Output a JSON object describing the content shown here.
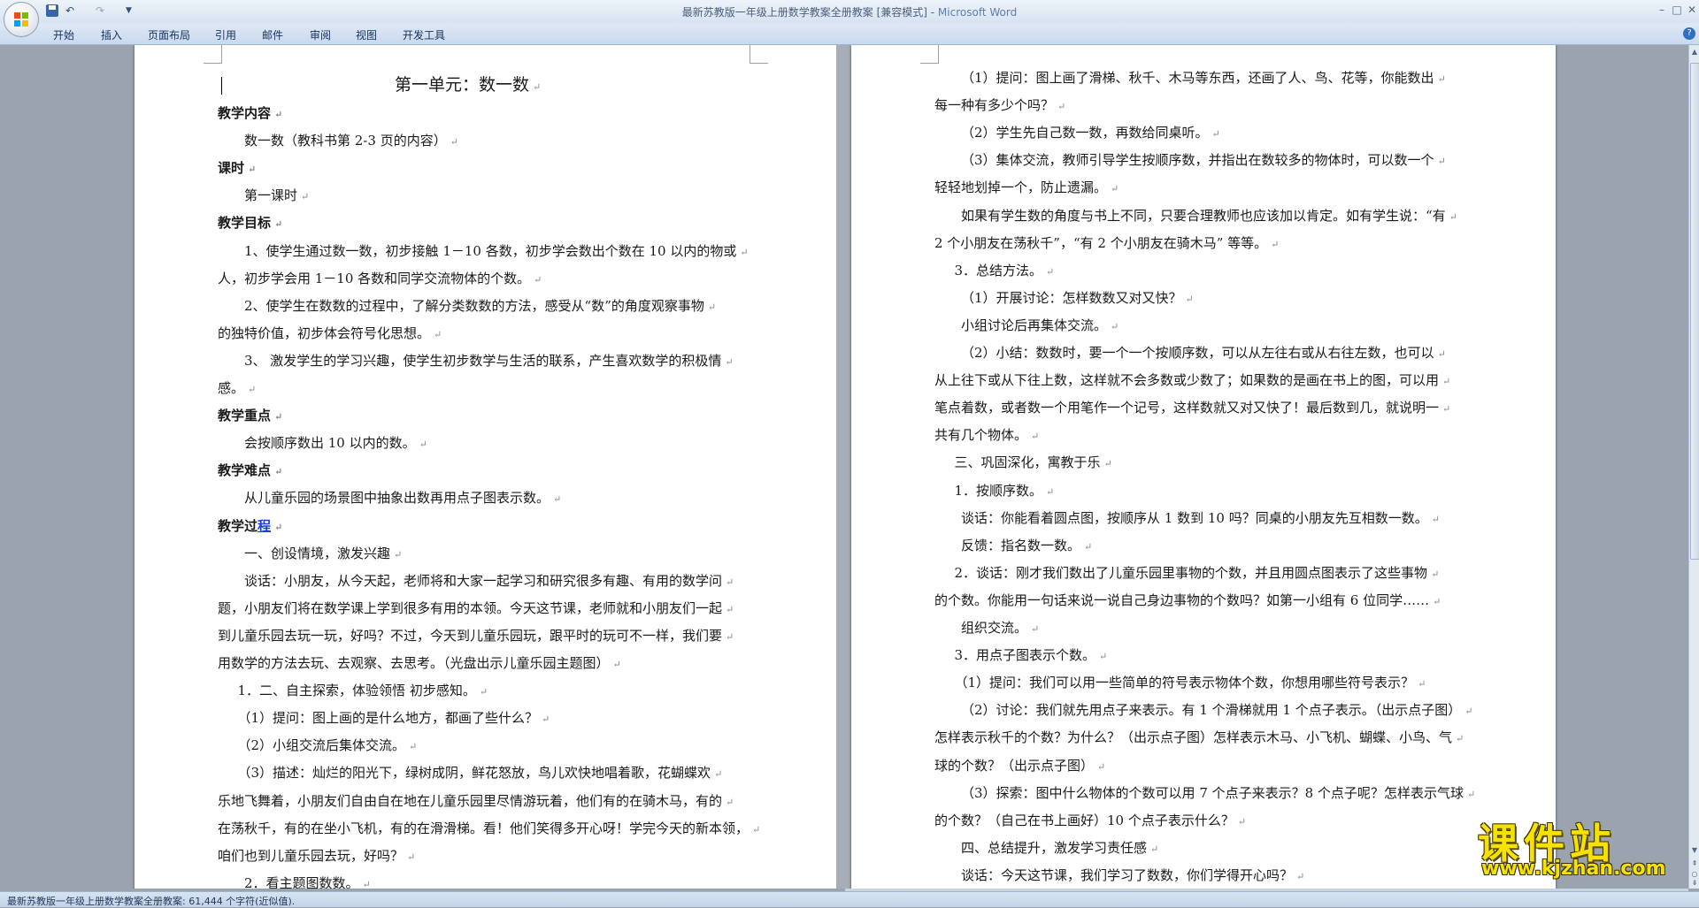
{
  "window": {
    "title": "最新苏教版一年级上册数学教案全册教案 [兼容模式] - ",
    "app_name": "Microsoft Word"
  },
  "qat": {
    "undo": "↶",
    "redo": "↷",
    "dropdown": "▼"
  },
  "ribbon": {
    "tabs": [
      "开始",
      "插入",
      "页面布局",
      "引用",
      "邮件",
      "审阅",
      "视图",
      "开发工具"
    ],
    "help": "?"
  },
  "window_buttons": {
    "minimize": "–",
    "maximize": "□",
    "close": "✕"
  },
  "page_left": {
    "heading": "第一单元：数一数",
    "lines": [
      {
        "text": "教学内容",
        "bold": true,
        "indent": 0
      },
      {
        "text": "数一数（教科书第 2-3 页的内容）",
        "bold": false,
        "indent": 2
      },
      {
        "text": "课时",
        "bold": true,
        "indent": 0
      },
      {
        "text": "第一课时",
        "bold": false,
        "indent": 2
      },
      {
        "text": "教学目标",
        "bold": true,
        "indent": 0
      },
      {
        "text": "1、使学生通过数一数，初步接触 1－10 各数，初步学会数出个数在 10 以内的物或",
        "bold": false,
        "indent": 2
      },
      {
        "text": "人，初步学会用 1－10 各数和同学交流物体的个数。",
        "bold": false,
        "indent": 0
      },
      {
        "text": "2、使学生在数数的过程中，了解分类数数的方法，感受从“数”的角度观察事物",
        "bold": false,
        "indent": 2
      },
      {
        "text": "的独特价值，初步体会符号化思想。",
        "bold": false,
        "indent": 0
      },
      {
        "text": "3、 激发学生的学习兴趣，使学生初步数学与生活的联系，产生喜欢数学的积极情",
        "bold": false,
        "indent": 2
      },
      {
        "text": "感。",
        "bold": false,
        "indent": 0
      },
      {
        "text": "教学重点",
        "bold": true,
        "indent": 0
      },
      {
        "text": "会按顺序数出 10 以内的数。",
        "bold": false,
        "indent": 2
      },
      {
        "text": "教学难点",
        "bold": true,
        "indent": 0
      },
      {
        "text": "从儿童乐园的场景图中抽象出数再用点子图表示数。",
        "bold": false,
        "indent": 2
      },
      {
        "text": "教学过",
        "bold": true,
        "indent": 0,
        "link": "程"
      },
      {
        "text": "一、创设情境，激发兴趣",
        "bold": false,
        "indent": 2
      },
      {
        "text": "谈话：小朋友，从今天起，老师将和大家一起学习和研究很多有趣、有用的数学问",
        "bold": false,
        "indent": 2
      },
      {
        "text": "题，小朋友们将在数学课上学到很多有用的本领。今天这节课，老师就和小朋友们一起",
        "bold": false,
        "indent": 0
      },
      {
        "text": "到儿童乐园去玩一玩，好吗？不过，今天到儿童乐园玩，跟平时的玩可不一样，我们要",
        "bold": false,
        "indent": 0
      },
      {
        "text": "用数学的方法去玩、去观察、去思考。（光盘出示儿童乐园主题图）",
        "bold": false,
        "indent": 0
      },
      {
        "text": "1．二、自主探索，体验领悟   初步感知。",
        "bold": false,
        "indent": 1.5
      },
      {
        "text": "（1）提问：图上画的是什么地方，都画了些什么？",
        "bold": false,
        "indent": 1.5
      },
      {
        "text": "（2）小组交流后集体交流。",
        "bold": false,
        "indent": 1.5
      },
      {
        "text": "（3）描述：灿烂的阳光下，绿树成阴，鲜花怒放，鸟儿欢快地唱着歌，花蝴蝶欢",
        "bold": false,
        "indent": 1.5
      },
      {
        "text": "乐地飞舞着，小朋友们自由自在地在儿童乐园里尽情游玩着，他们有的在骑木马，有的",
        "bold": false,
        "indent": 0
      },
      {
        "text": "在荡秋千，有的在坐小飞机，有的在滑滑梯。看！他们笑得多开心呀！学完今天的新本领，",
        "bold": false,
        "indent": 0
      },
      {
        "text": "咱们也到儿童乐园去玩，好吗？",
        "bold": false,
        "indent": 0
      },
      {
        "text": "2．看主题图数数。",
        "bold": false,
        "indent": 2
      }
    ]
  },
  "page_right": {
    "lines": [
      {
        "text": "（1）提问：图上画了滑梯、秋千、木马等东西，还画了人、鸟、花等，你能数出",
        "indent": 2
      },
      {
        "text": "每一种有多少个吗？",
        "indent": 0
      },
      {
        "text": "（2）学生先自己数一数，再数给同桌听。",
        "indent": 2
      },
      {
        "text": "（3）集体交流，教师引导学生按顺序数，并指出在数较多的物体时，可以数一个",
        "indent": 2
      },
      {
        "text": "轻轻地划掉一个，防止遗漏。",
        "indent": 0
      },
      {
        "text": "如果有学生数的角度与书上不同，只要合理教师也应该加以肯定。如有学生说：“有",
        "indent": 2
      },
      {
        "text": "2 个小朋友在荡秋千”，“有 2 个小朋友在骑木马” 等等。",
        "indent": 0
      },
      {
        "text": "3．总结方法。",
        "indent": 1.5
      },
      {
        "text": "（1）开展讨论：怎样数数又对又快？",
        "indent": 2
      },
      {
        "text": "小组讨论后再集体交流。",
        "indent": 2
      },
      {
        "text": "（2）小结：数数时，要一个一个按顺序数，可以从左往右或从右往左数，也可以",
        "indent": 2
      },
      {
        "text": "从上往下或从下往上数，这样就不会多数或少数了；如果数的是画在书上的图，可以用",
        "indent": 0
      },
      {
        "text": "笔点着数，或者数一个用笔作一个记号，这样数就又对又快了！最后数到几，就说明一",
        "indent": 0
      },
      {
        "text": "共有几个物体。",
        "indent": 0
      },
      {
        "text": "三、巩固深化，寓教于乐",
        "indent": 1.5
      },
      {
        "text": "1．按顺序数。",
        "indent": 1.5
      },
      {
        "text": "谈话：你能看着圆点图，按顺序从 1 数到 10 吗？同桌的小朋友先互相数一数。",
        "indent": 2
      },
      {
        "text": "反馈：指名数一数。",
        "indent": 2
      },
      {
        "text": "2．谈话：刚才我们数出了儿童乐园里事物的个数，并且用圆点图表示了这些事物",
        "indent": 1.5
      },
      {
        "text": "的个数。你能用一句话来说一说自己身边事物的个数吗？如第一小组有 6 位同学……",
        "indent": 0
      },
      {
        "text": "组织交流。",
        "indent": 2
      },
      {
        "text": "3．用点子图表示个数。",
        "indent": 1.5
      },
      {
        "text": "（1）提问：我们可以用一些简单的符号表示物体个数，你想用哪些符号表示？",
        "indent": 1.5
      },
      {
        "text": "（2）讨论：我们就先用点子来表示。有 1 个滑梯就用 1 个点子表示。（出示点子图）",
        "indent": 2
      },
      {
        "text": "怎样表示秋千的个数？为什么？（出示点子图）怎样表示木马、小飞机、蝴蝶、小鸟、气",
        "indent": 0
      },
      {
        "text": "球的个数？（出示点子图）",
        "indent": 0
      },
      {
        "text": "（3）探索：图中什么物体的个数可以用 7 个点子来表示？8 个点子呢？怎样表示气球",
        "indent": 2
      },
      {
        "text": "的个数？（自己在书上画好）10 个点子表示什么？",
        "indent": 0
      },
      {
        "text": "四、总结提升，激发学习责任感",
        "indent": 2
      },
      {
        "text": "谈话：今天这节课，我们学习了数数，你们学得开心吗？",
        "indent": 2
      }
    ]
  },
  "paragraph_mark": "↵",
  "status_bar": {
    "text": "最新苏教版一年级上册数学教案全册教案: 61,444 个字符(近似值)."
  },
  "watermark": {
    "text": "课件站",
    "url": "www.kjzhan.com"
  }
}
